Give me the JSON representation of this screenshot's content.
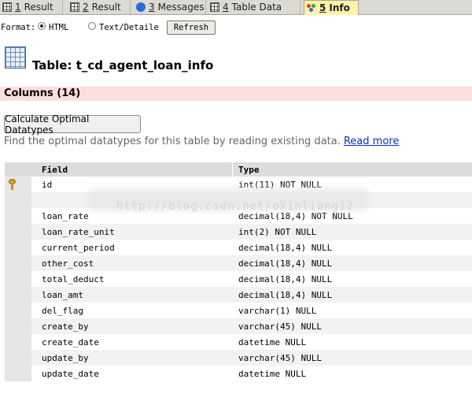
{
  "tabs": [
    {
      "num": "1",
      "label": "Result",
      "icon": "grid-icon"
    },
    {
      "num": "2",
      "label": "Result",
      "icon": "grid-icon"
    },
    {
      "num": "3",
      "label": "Messages",
      "icon": "message-icon"
    },
    {
      "num": "4",
      "label": "Table Data",
      "icon": "table-data-icon"
    },
    {
      "num": "5",
      "label": "Info",
      "icon": "info-icon",
      "active": true
    }
  ],
  "format": {
    "label": "Format:",
    "option_html": "HTML",
    "option_text": "Text/Detailed",
    "selected": "HTML",
    "refresh_label": "Refresh"
  },
  "title": "Table: t_cd_agent_loan_info",
  "columns_header": "Columns (14)",
  "calc_button": "Calculate Optimal Datatypes",
  "description": "Find the optimal datatypes for this table by reading existing data.",
  "read_more": "Read more",
  "table": {
    "headers": [
      "Field",
      "Type"
    ],
    "rows": [
      {
        "field": "id",
        "type": "int(11) NOT NULL",
        "key": true
      },
      {
        "field": "",
        "type": ""
      },
      {
        "field": "loan_rate",
        "type": "decimal(18,4) NOT NULL"
      },
      {
        "field": "loan_rate_unit",
        "type": "int(2) NOT NULL"
      },
      {
        "field": "current_period",
        "type": "decimal(18,4) NULL"
      },
      {
        "field": "other_cost",
        "type": "decimal(18,4) NULL"
      },
      {
        "field": "total_deduct",
        "type": "decimal(18,4) NULL"
      },
      {
        "field": "loan_amt",
        "type": "decimal(18,4) NULL"
      },
      {
        "field": "del_flag",
        "type": "varchar(1) NULL"
      },
      {
        "field": "create_by",
        "type": "varchar(45) NULL"
      },
      {
        "field": "create_date",
        "type": "datetime NULL"
      },
      {
        "field": "update_by",
        "type": "varchar(45) NULL"
      },
      {
        "field": "update_date",
        "type": "datetime NULL"
      }
    ]
  },
  "watermark": "http://blog.csdn.net/oXinliang12",
  "colors": {
    "active_tab": "#fff3a8",
    "columns_bar": "#ffdede",
    "link": "#0033cc"
  }
}
